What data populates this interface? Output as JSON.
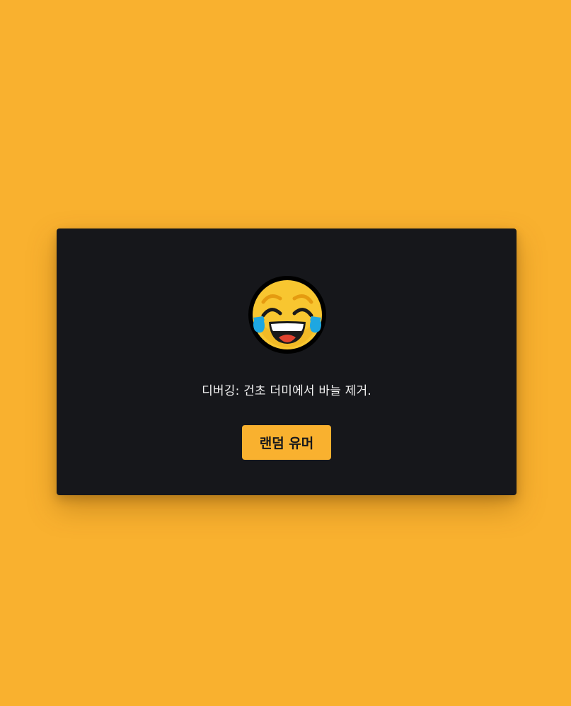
{
  "card": {
    "emoji_icon": "face-with-tears-of-joy-icon",
    "joke_text": "디버깅: 건초 더미에서 바늘 제거.",
    "button_label": "랜덤 유머"
  },
  "colors": {
    "background": "#f9b12f",
    "card": "#16171b",
    "text": "#f2f2f2",
    "button": "#f9b12f",
    "button_text": "#16171b"
  }
}
